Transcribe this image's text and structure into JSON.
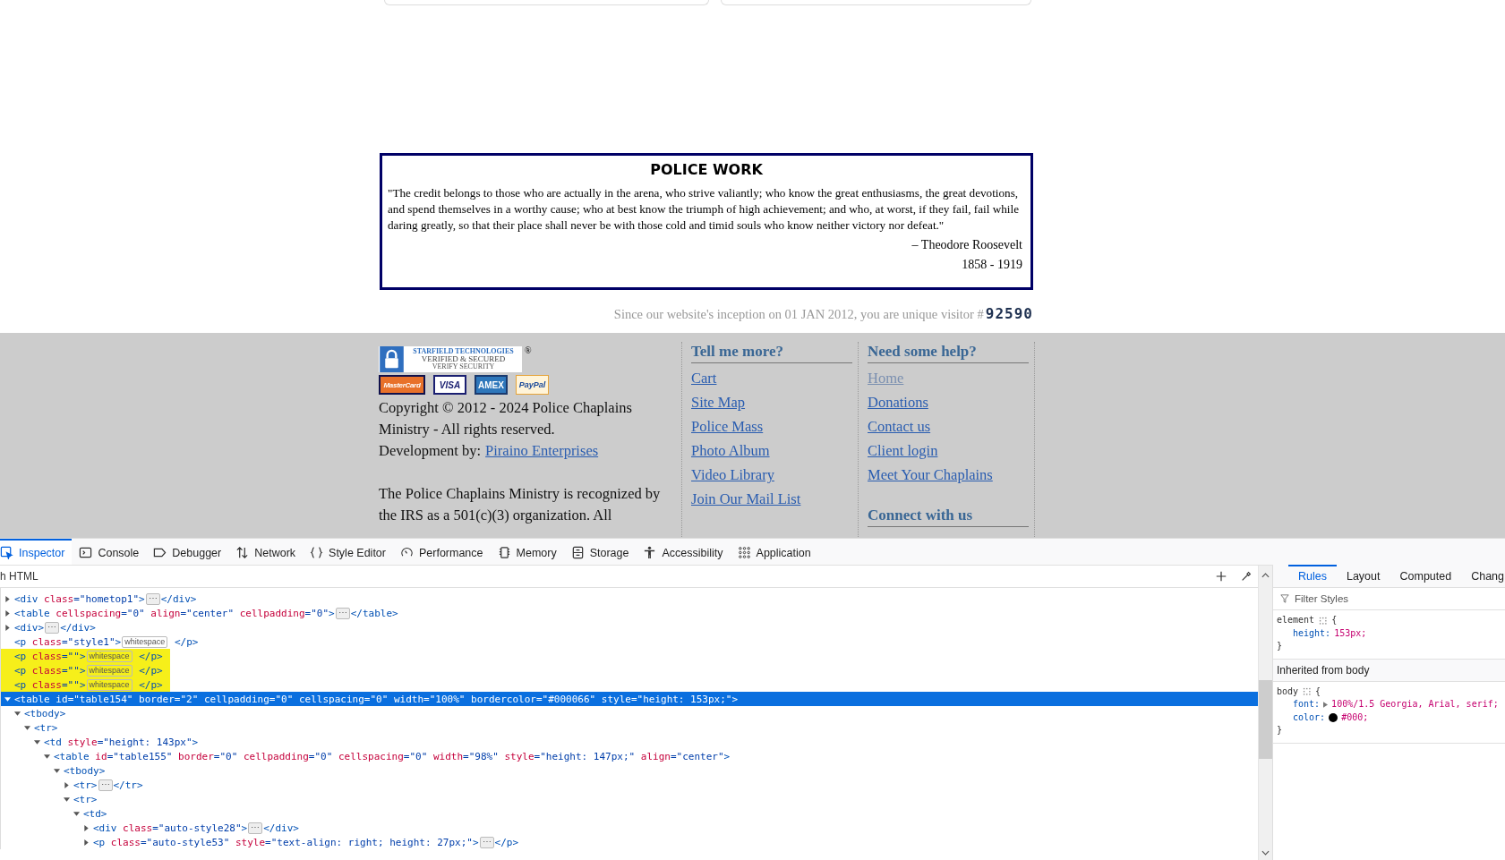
{
  "page": {
    "quote_box": {
      "title": "POLICE WORK",
      "quote": "\"The credit belongs to those who are actually in the arena, who strive valiantly; who know the great enthusiasms, the great devotions, and spend themselves in a worthy cause; who at best know the triumph of high achievement; and who, at worst, if they fail, fail while daring greatly, so that their place shall never be with those cold and timid souls who know neither victory nor defeat.\"",
      "author": "– Theodore Roosevelt",
      "years": "1858 - 1919"
    },
    "visitor": {
      "text": "Since our website's inception on 01 JAN 2012, you are unique visitor #",
      "count": "92590"
    },
    "footer": {
      "seal": {
        "brand": "STARFIELD TECHNOLOGIES",
        "line1": "VERIFIED & SECURED",
        "line2": "VERIFY SECURITY",
        "mark": "®"
      },
      "payment_cards": [
        {
          "kind": "mastercard",
          "label": "MasterCard"
        },
        {
          "kind": "visa",
          "label": "VISA"
        },
        {
          "kind": "amex",
          "label": "AMEX"
        },
        {
          "kind": "paypal",
          "label": "PayPal"
        }
      ],
      "copyright": "Copyright © 2012 - 2024 Police Chaplains Ministry - All rights reserved.",
      "development_label": "Development by:",
      "development_link": "Piraino Enterprises",
      "recognition": "The Police Chaplains Ministry is recognized by the IRS as a 501(c)(3) organization. All",
      "columns": [
        {
          "heading": "Tell me more?",
          "links": [
            {
              "label": "Cart",
              "current": false
            },
            {
              "label": "Site Map",
              "current": false
            },
            {
              "label": "Police Mass",
              "current": false
            },
            {
              "label": "Photo Album",
              "current": false
            },
            {
              "label": "Video Library",
              "current": false
            },
            {
              "label": "Join Our Mail List",
              "current": false
            }
          ]
        },
        {
          "heading": "Need some help?",
          "links": [
            {
              "label": "Home",
              "current": true
            },
            {
              "label": "Donations",
              "current": false
            },
            {
              "label": "Contact us",
              "current": false
            },
            {
              "label": "Client login",
              "current": false
            },
            {
              "label": "Meet Your Chaplains",
              "current": false
            }
          ],
          "subheading": "Connect with us"
        }
      ]
    }
  },
  "devtools": {
    "tabs": [
      {
        "kind": "inspector",
        "label": "Inspector",
        "selected": true
      },
      {
        "kind": "console",
        "label": "Console",
        "selected": false
      },
      {
        "kind": "debugger",
        "label": "Debugger",
        "selected": false
      },
      {
        "kind": "network",
        "label": "Network",
        "selected": false
      },
      {
        "kind": "braces",
        "label": "Style Editor",
        "selected": false
      },
      {
        "kind": "gauge",
        "label": "Performance",
        "selected": false
      },
      {
        "kind": "chip",
        "label": "Memory",
        "selected": false
      },
      {
        "kind": "storage",
        "label": "Storage",
        "selected": false
      },
      {
        "kind": "person",
        "label": "Accessibility",
        "selected": false
      },
      {
        "kind": "grid",
        "label": "Application",
        "selected": false
      }
    ],
    "search": {
      "placeholder": "h HTML"
    },
    "tree": [
      {
        "kind": "branch",
        "expanded": false,
        "selected": false,
        "highlighted": false,
        "segments": [
          {
            "kind": "code",
            "tokens": [
              {
                "kind": "tag",
                "s": "<div"
              },
              {
                "kind": "attr",
                "s": " class"
              },
              {
                "kind": "value",
                "s": "=\"hometop1\""
              },
              {
                "kind": "tag",
                "s": ">"
              }
            ]
          },
          {
            "kind": "more",
            "text": "⋯"
          },
          {
            "kind": "code",
            "tokens": [
              {
                "kind": "tag",
                "s": "</div>"
              }
            ]
          }
        ]
      },
      {
        "kind": "branch",
        "expanded": false,
        "selected": false,
        "highlighted": false,
        "segments": [
          {
            "kind": "code",
            "tokens": [
              {
                "kind": "tag",
                "s": "<table"
              },
              {
                "kind": "attr",
                "s": " cellspacing"
              },
              {
                "kind": "value",
                "s": "=\"0\""
              },
              {
                "kind": "attr",
                "s": " align"
              },
              {
                "kind": "value",
                "s": "=\"center\""
              },
              {
                "kind": "attr",
                "s": " cellpadding"
              },
              {
                "kind": "value",
                "s": "=\"0\""
              },
              {
                "kind": "tag",
                "s": ">"
              }
            ]
          },
          {
            "kind": "more",
            "text": "⋯"
          },
          {
            "kind": "code",
            "tokens": [
              {
                "kind": "tag",
                "s": "</table>"
              }
            ]
          }
        ]
      },
      {
        "kind": "branch",
        "expanded": false,
        "selected": false,
        "highlighted": false,
        "segments": [
          {
            "kind": "code",
            "tokens": [
              {
                "kind": "tag",
                "s": "<div>"
              }
            ]
          },
          {
            "kind": "more",
            "text": "⋯"
          },
          {
            "kind": "code",
            "tokens": [
              {
                "kind": "tag",
                "s": "</div>"
              }
            ]
          }
        ]
      },
      {
        "kind": "leaf",
        "selected": false,
        "highlighted": false,
        "segments": [
          {
            "kind": "code",
            "tokens": [
              {
                "kind": "tag",
                "s": "<p"
              },
              {
                "kind": "attr",
                "s": " class"
              },
              {
                "kind": "value",
                "s": "=\"style1\""
              },
              {
                "kind": "tag",
                "s": ">"
              }
            ]
          },
          {
            "kind": "badge",
            "text": "whitespace"
          },
          {
            "kind": "code",
            "tokens": [
              {
                "kind": "tag",
                "s": " </p>"
              }
            ]
          }
        ]
      },
      {
        "kind": "leaf",
        "selected": false,
        "highlighted": true,
        "segments": [
          {
            "kind": "code",
            "tokens": [
              {
                "kind": "tag",
                "s": "<p"
              },
              {
                "kind": "attr",
                "s": " class"
              },
              {
                "kind": "value",
                "s": "=\"\""
              },
              {
                "kind": "tag",
                "s": ">"
              }
            ]
          },
          {
            "kind": "badge",
            "text": "whitespace"
          },
          {
            "kind": "code",
            "tokens": [
              {
                "kind": "tag",
                "s": " </p>"
              }
            ]
          }
        ]
      },
      {
        "kind": "leaf",
        "selected": false,
        "highlighted": true,
        "segments": [
          {
            "kind": "code",
            "tokens": [
              {
                "kind": "tag",
                "s": "<p"
              },
              {
                "kind": "attr",
                "s": " class"
              },
              {
                "kind": "value",
                "s": "=\"\""
              },
              {
                "kind": "tag",
                "s": ">"
              }
            ]
          },
          {
            "kind": "badge",
            "text": "whitespace"
          },
          {
            "kind": "code",
            "tokens": [
              {
                "kind": "tag",
                "s": " </p>"
              }
            ]
          }
        ]
      },
      {
        "kind": "leaf",
        "selected": false,
        "highlighted": true,
        "segments": [
          {
            "kind": "code",
            "tokens": [
              {
                "kind": "tag",
                "s": "<p"
              },
              {
                "kind": "attr",
                "s": " class"
              },
              {
                "kind": "value",
                "s": "=\"\""
              },
              {
                "kind": "tag",
                "s": ">"
              }
            ]
          },
          {
            "kind": "badge",
            "text": "whitespace"
          },
          {
            "kind": "code",
            "tokens": [
              {
                "kind": "tag",
                "s": " </p>"
              }
            ]
          }
        ]
      },
      {
        "kind": "branch",
        "expanded": true,
        "selected": true,
        "highlighted": false,
        "segments": [
          {
            "kind": "code",
            "tokens": [
              {
                "kind": "tag",
                "s": "<table"
              },
              {
                "kind": "attr",
                "s": " id"
              },
              {
                "kind": "value",
                "s": "=\"table154\""
              },
              {
                "kind": "attr",
                "s": " border"
              },
              {
                "kind": "value",
                "s": "=\"2\""
              },
              {
                "kind": "attr",
                "s": " cellpadding"
              },
              {
                "kind": "value",
                "s": "=\"0\""
              },
              {
                "kind": "attr",
                "s": " cellspacing"
              },
              {
                "kind": "value",
                "s": "=\"0\""
              },
              {
                "kind": "attr",
                "s": " width"
              },
              {
                "kind": "value",
                "s": "=\"100%\""
              },
              {
                "kind": "attr",
                "s": " bordercolor"
              },
              {
                "kind": "value",
                "s": "=\"#000066\""
              },
              {
                "kind": "attr",
                "s": " style"
              },
              {
                "kind": "value",
                "s": "=\"height: 153px;\""
              },
              {
                "kind": "tag",
                "s": ">"
              }
            ]
          }
        ],
        "children": [
          {
            "kind": "branch",
            "expanded": true,
            "selected": false,
            "highlighted": false,
            "segments": [
              {
                "kind": "code",
                "tokens": [
                  {
                    "kind": "tag",
                    "s": "<tbody>"
                  }
                ]
              }
            ],
            "children": [
              {
                "kind": "branch",
                "expanded": true,
                "selected": false,
                "highlighted": false,
                "segments": [
                  {
                    "kind": "code",
                    "tokens": [
                      {
                        "kind": "tag",
                        "s": "<tr>"
                      }
                    ]
                  }
                ],
                "children": [
                  {
                    "kind": "branch",
                    "expanded": true,
                    "selected": false,
                    "highlighted": false,
                    "segments": [
                      {
                        "kind": "code",
                        "tokens": [
                          {
                            "kind": "tag",
                            "s": "<td"
                          },
                          {
                            "kind": "attr",
                            "s": " style"
                          },
                          {
                            "kind": "value",
                            "s": "=\"height: 143px\""
                          },
                          {
                            "kind": "tag",
                            "s": ">"
                          }
                        ]
                      }
                    ],
                    "children": [
                      {
                        "kind": "branch",
                        "expanded": true,
                        "selected": false,
                        "highlighted": false,
                        "segments": [
                          {
                            "kind": "code",
                            "tokens": [
                              {
                                "kind": "tag",
                                "s": "<table"
                              },
                              {
                                "kind": "attr",
                                "s": " id"
                              },
                              {
                                "kind": "value",
                                "s": "=\"table155\""
                              },
                              {
                                "kind": "attr",
                                "s": " border"
                              },
                              {
                                "kind": "value",
                                "s": "=\"0\""
                              },
                              {
                                "kind": "attr",
                                "s": " cellpadding"
                              },
                              {
                                "kind": "value",
                                "s": "=\"0\""
                              },
                              {
                                "kind": "attr",
                                "s": " cellspacing"
                              },
                              {
                                "kind": "value",
                                "s": "=\"0\""
                              },
                              {
                                "kind": "attr",
                                "s": " width"
                              },
                              {
                                "kind": "value",
                                "s": "=\"98%\""
                              },
                              {
                                "kind": "attr",
                                "s": " style"
                              },
                              {
                                "kind": "value",
                                "s": "=\"height: 147px;\""
                              },
                              {
                                "kind": "attr",
                                "s": " align"
                              },
                              {
                                "kind": "value",
                                "s": "=\"center\""
                              },
                              {
                                "kind": "tag",
                                "s": ">"
                              }
                            ]
                          }
                        ],
                        "children": [
                          {
                            "kind": "branch",
                            "expanded": true,
                            "selected": false,
                            "highlighted": false,
                            "segments": [
                              {
                                "kind": "code",
                                "tokens": [
                                  {
                                    "kind": "tag",
                                    "s": "<tbody>"
                                  }
                                ]
                              }
                            ],
                            "children": [
                              {
                                "kind": "branch",
                                "expanded": false,
                                "selected": false,
                                "highlighted": false,
                                "segments": [
                                  {
                                    "kind": "code",
                                    "tokens": [
                                      {
                                        "kind": "tag",
                                        "s": "<tr>"
                                      }
                                    ]
                                  },
                                  {
                                    "kind": "more",
                                    "text": "⋯"
                                  },
                                  {
                                    "kind": "code",
                                    "tokens": [
                                      {
                                        "kind": "tag",
                                        "s": "</tr>"
                                      }
                                    ]
                                  }
                                ]
                              },
                              {
                                "kind": "branch",
                                "expanded": true,
                                "selected": false,
                                "highlighted": false,
                                "segments": [
                                  {
                                    "kind": "code",
                                    "tokens": [
                                      {
                                        "kind": "tag",
                                        "s": "<tr>"
                                      }
                                    ]
                                  }
                                ],
                                "children": [
                                  {
                                    "kind": "branch",
                                    "expanded": true,
                                    "selected": false,
                                    "highlighted": false,
                                    "segments": [
                                      {
                                        "kind": "code",
                                        "tokens": [
                                          {
                                            "kind": "tag",
                                            "s": "<td>"
                                          }
                                        ]
                                      }
                                    ],
                                    "children": [
                                      {
                                        "kind": "branch",
                                        "expanded": false,
                                        "selected": false,
                                        "highlighted": false,
                                        "segments": [
                                          {
                                            "kind": "code",
                                            "tokens": [
                                              {
                                                "kind": "tag",
                                                "s": "<div"
                                              },
                                              {
                                                "kind": "attr",
                                                "s": " class"
                                              },
                                              {
                                                "kind": "value",
                                                "s": "=\"auto-style28\""
                                              },
                                              {
                                                "kind": "tag",
                                                "s": ">"
                                              }
                                            ]
                                          },
                                          {
                                            "kind": "more",
                                            "text": "⋯"
                                          },
                                          {
                                            "kind": "code",
                                            "tokens": [
                                              {
                                                "kind": "tag",
                                                "s": "</div>"
                                              }
                                            ]
                                          }
                                        ]
                                      },
                                      {
                                        "kind": "branch",
                                        "expanded": false,
                                        "selected": false,
                                        "highlighted": false,
                                        "segments": [
                                          {
                                            "kind": "code",
                                            "tokens": [
                                              {
                                                "kind": "tag",
                                                "s": "<p"
                                              },
                                              {
                                                "kind": "attr",
                                                "s": " class"
                                              },
                                              {
                                                "kind": "value",
                                                "s": "=\"auto-style53\""
                                              },
                                              {
                                                "kind": "attr",
                                                "s": " style"
                                              },
                                              {
                                                "kind": "value",
                                                "s": "=\"text-align: right; height: 27px;\""
                                              },
                                              {
                                                "kind": "tag",
                                                "s": ">"
                                              }
                                            ]
                                          },
                                          {
                                            "kind": "more",
                                            "text": "⋯"
                                          },
                                          {
                                            "kind": "code",
                                            "tokens": [
                                              {
                                                "kind": "tag",
                                                "s": "</p>"
                                              }
                                            ]
                                          }
                                        ]
                                      }
                                    ]
                                  }
                                ]
                              }
                            ]
                          }
                        ]
                      }
                    ]
                  }
                ]
              }
            ]
          }
        ]
      }
    ],
    "sidebar": {
      "tabs": [
        {
          "label": "Rules",
          "selected": true
        },
        {
          "label": "Layout",
          "selected": false
        },
        {
          "label": "Computed",
          "selected": false
        },
        {
          "label": "Chang",
          "selected": false
        }
      ],
      "filter": {
        "placeholder": "Filter Styles"
      },
      "rules": [
        {
          "selector": "element",
          "open": "{",
          "close": "}",
          "declarations": [
            {
              "kind": "plain",
              "property": "height:",
              "value": "153px;"
            }
          ]
        },
        {
          "heading": "Inherited from body",
          "selector": "body",
          "open": "{",
          "close": "}",
          "declarations": [
            {
              "kind": "shorthand",
              "property": "font:",
              "value": "100%/1.5 Georgia, Arial, serif;"
            },
            {
              "kind": "color",
              "property": "color:",
              "value": "#000;",
              "color": "#000000"
            }
          ]
        }
      ]
    }
  }
}
